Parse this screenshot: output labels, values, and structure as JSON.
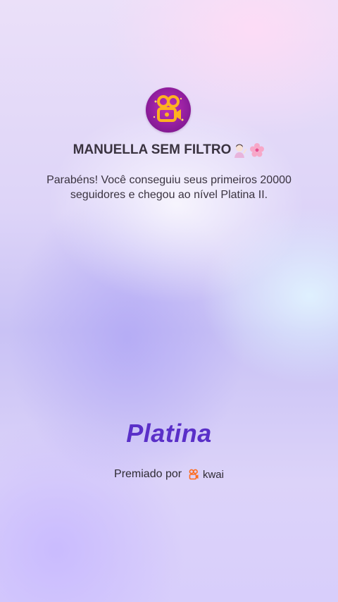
{
  "profile": {
    "logo_icon": "kwai-logo-icon",
    "name": "MANUELLA SEM FILTRO",
    "emojis": [
      "woman-raising-hand-emoji",
      "cherry-blossom-emoji"
    ]
  },
  "message": "Parabéns! Você conseguiu seus primeiros 20000 seguidores e chegou ao nível Platina II.",
  "level": "Platina",
  "awarded": {
    "prefix": "Premiado por",
    "brand_icon": "kwai-small-icon",
    "brand": "kwai"
  },
  "colors": {
    "level_text": "#5a2fc8",
    "brand_orange": "#ff6a1a",
    "logo_bg": "#a3229f"
  }
}
